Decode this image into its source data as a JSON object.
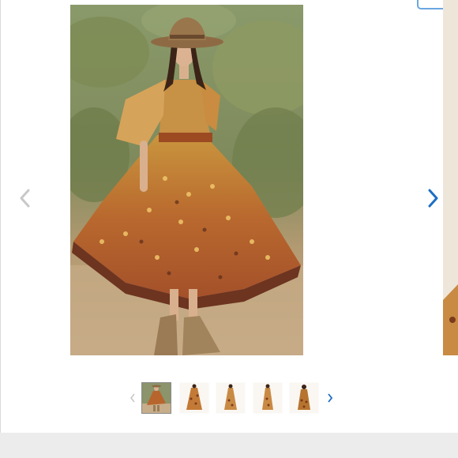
{
  "product_gallery": {
    "main_image": {
      "alt": "",
      "icon": "product-photo"
    },
    "prev_button": {
      "icon": "chevron-left-icon",
      "color": "#c8c8c8"
    },
    "next_button": {
      "icon": "chevron-right-icon",
      "color": "#1d6fc4"
    },
    "thumbnails": [
      {
        "index": 1,
        "active": true
      },
      {
        "index": 2,
        "active": false
      },
      {
        "index": 3,
        "active": false
      },
      {
        "index": 4,
        "active": false
      },
      {
        "index": 5,
        "active": false
      }
    ],
    "thumb_prev": {
      "icon": "chevron-left-icon",
      "color": "#c8c8c8"
    },
    "thumb_next": {
      "icon": "chevron-right-icon",
      "color": "#1d6fc4"
    }
  },
  "colors": {
    "accent": "#1d6fc4",
    "footer": "#ececec",
    "disabled_arrow": "#c8c8c8"
  }
}
